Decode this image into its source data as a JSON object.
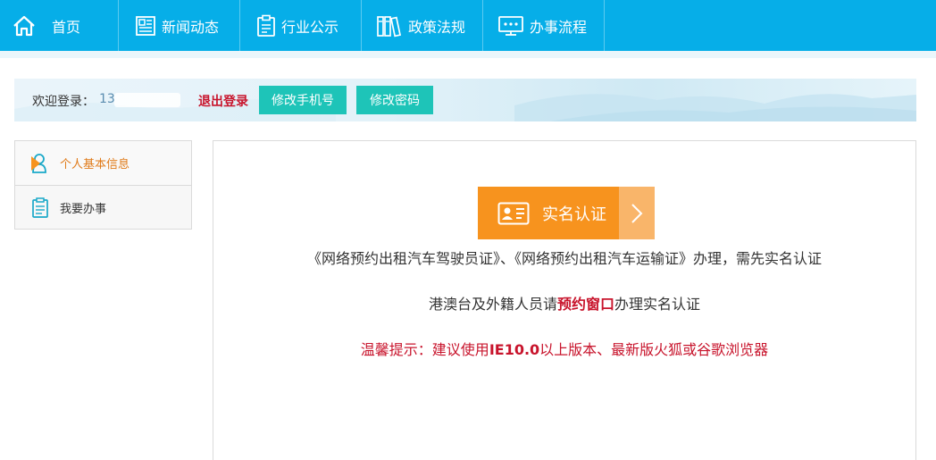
{
  "nav": {
    "home": "首页",
    "news": "新闻动态",
    "notice": "行业公示",
    "policy": "政策法规",
    "process": "办事流程"
  },
  "welcome": {
    "label": "欢迎登录：",
    "phone_prefix": "13",
    "logout": "退出登录",
    "change_phone": "修改手机号",
    "change_password": "修改密码"
  },
  "sidebar": {
    "items": [
      {
        "label": "个人基本信息",
        "active": true
      },
      {
        "label": "我要办事",
        "active": false
      }
    ]
  },
  "main": {
    "verify_button": "实名认证",
    "line1": "《网络预约出租汽车驾驶员证》、《网络预约出租汽车运输证》办理，需先实名认证",
    "line2_pre": "港澳台及外籍人员请",
    "line2_link": "预约窗口",
    "line2_post": "办理实名认证",
    "tip_pre": "温馨提示：建议使用",
    "tip_bold": "IE10.0",
    "tip_post": "以上版本、最新版火狐或谷歌浏览器"
  },
  "colors": {
    "nav_bg": "#06aee8",
    "accent_orange": "#f7931e",
    "teal_button": "#1ec4b8",
    "alert_red": "#c8142c"
  }
}
